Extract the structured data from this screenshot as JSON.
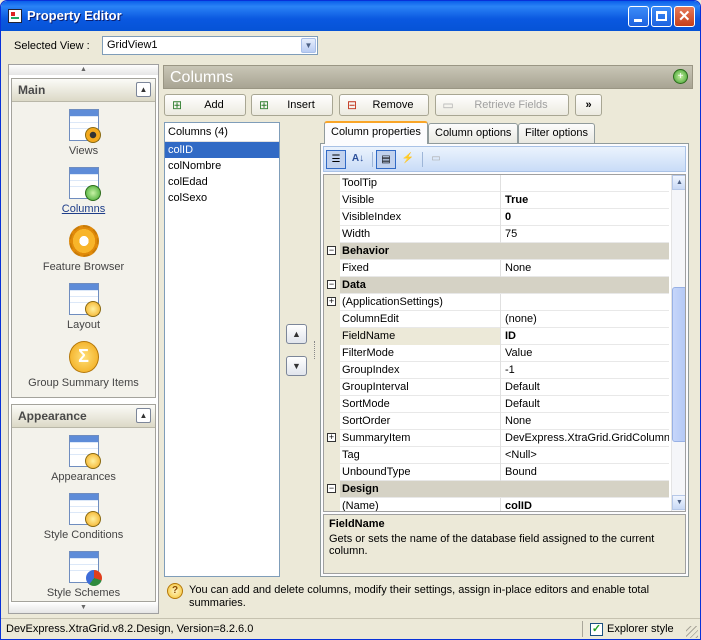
{
  "window": {
    "title": "Property Editor"
  },
  "selected_view": {
    "label": "Selected View :",
    "value": "GridView1"
  },
  "nav": {
    "groups": [
      {
        "title": "Main",
        "items": [
          {
            "label": "Views",
            "icon": "views-icon"
          },
          {
            "label": "Columns",
            "icon": "columns-icon"
          },
          {
            "label": "Feature Browser",
            "icon": "feature-browser-icon"
          },
          {
            "label": "Layout",
            "icon": "layout-icon"
          },
          {
            "label": "Group Summary Items",
            "icon": "group-summary-icon"
          }
        ]
      },
      {
        "title": "Appearance",
        "items": [
          {
            "label": "Appearances",
            "icon": "appearances-icon"
          },
          {
            "label": "Style Conditions",
            "icon": "style-conditions-icon"
          },
          {
            "label": "Style Schemes",
            "icon": "style-schemes-icon"
          }
        ]
      }
    ]
  },
  "panel": {
    "title": "Columns",
    "buttons": {
      "add": "Add",
      "insert": "Insert",
      "remove": "Remove",
      "retrieve": "Retrieve Fields",
      "more": "»"
    }
  },
  "columns_list": {
    "header": "Columns (4)",
    "items": [
      "colID",
      "colNombre",
      "colEdad",
      "colSexo"
    ]
  },
  "tabs": [
    "Column properties",
    "Column options",
    "Filter options"
  ],
  "properties": [
    {
      "name": "ToolTip",
      "value": "",
      "kind": "prop"
    },
    {
      "name": "Visible",
      "value": "True",
      "kind": "prop",
      "bold": true
    },
    {
      "name": "VisibleIndex",
      "value": "0",
      "kind": "prop",
      "bold": true
    },
    {
      "name": "Width",
      "value": "75",
      "kind": "prop"
    },
    {
      "name": "Behavior",
      "value": "",
      "kind": "cat"
    },
    {
      "name": "Fixed",
      "value": "None",
      "kind": "prop"
    },
    {
      "name": "Data",
      "value": "",
      "kind": "cat"
    },
    {
      "name": "(ApplicationSettings)",
      "value": "",
      "kind": "expand"
    },
    {
      "name": "ColumnEdit",
      "value": "(none)",
      "kind": "prop"
    },
    {
      "name": "FieldName",
      "value": "ID",
      "kind": "prop",
      "bold": true,
      "selected": true
    },
    {
      "name": "FilterMode",
      "value": "Value",
      "kind": "prop"
    },
    {
      "name": "GroupIndex",
      "value": "-1",
      "kind": "prop"
    },
    {
      "name": "GroupInterval",
      "value": "Default",
      "kind": "prop"
    },
    {
      "name": "SortMode",
      "value": "Default",
      "kind": "prop"
    },
    {
      "name": "SortOrder",
      "value": "None",
      "kind": "prop"
    },
    {
      "name": "SummaryItem",
      "value": "DevExpress.XtraGrid.GridColumnSu",
      "kind": "expand"
    },
    {
      "name": "Tag",
      "value": "<Null>",
      "kind": "prop"
    },
    {
      "name": "UnboundType",
      "value": "Bound",
      "kind": "prop"
    },
    {
      "name": "Design",
      "value": "",
      "kind": "cat"
    },
    {
      "name": "(Name)",
      "value": "colID",
      "kind": "prop",
      "bold": true
    }
  ],
  "description": {
    "title": "FieldName",
    "text": "Gets or sets the name of the database field assigned to the current column."
  },
  "hint": "You can add and delete columns, modify their settings, assign in-place editors and enable total summaries.",
  "status": {
    "text": "DevExpress.XtraGrid.v8.2.Design, Version=8.2.6.0",
    "explorer_style": "Explorer style"
  }
}
